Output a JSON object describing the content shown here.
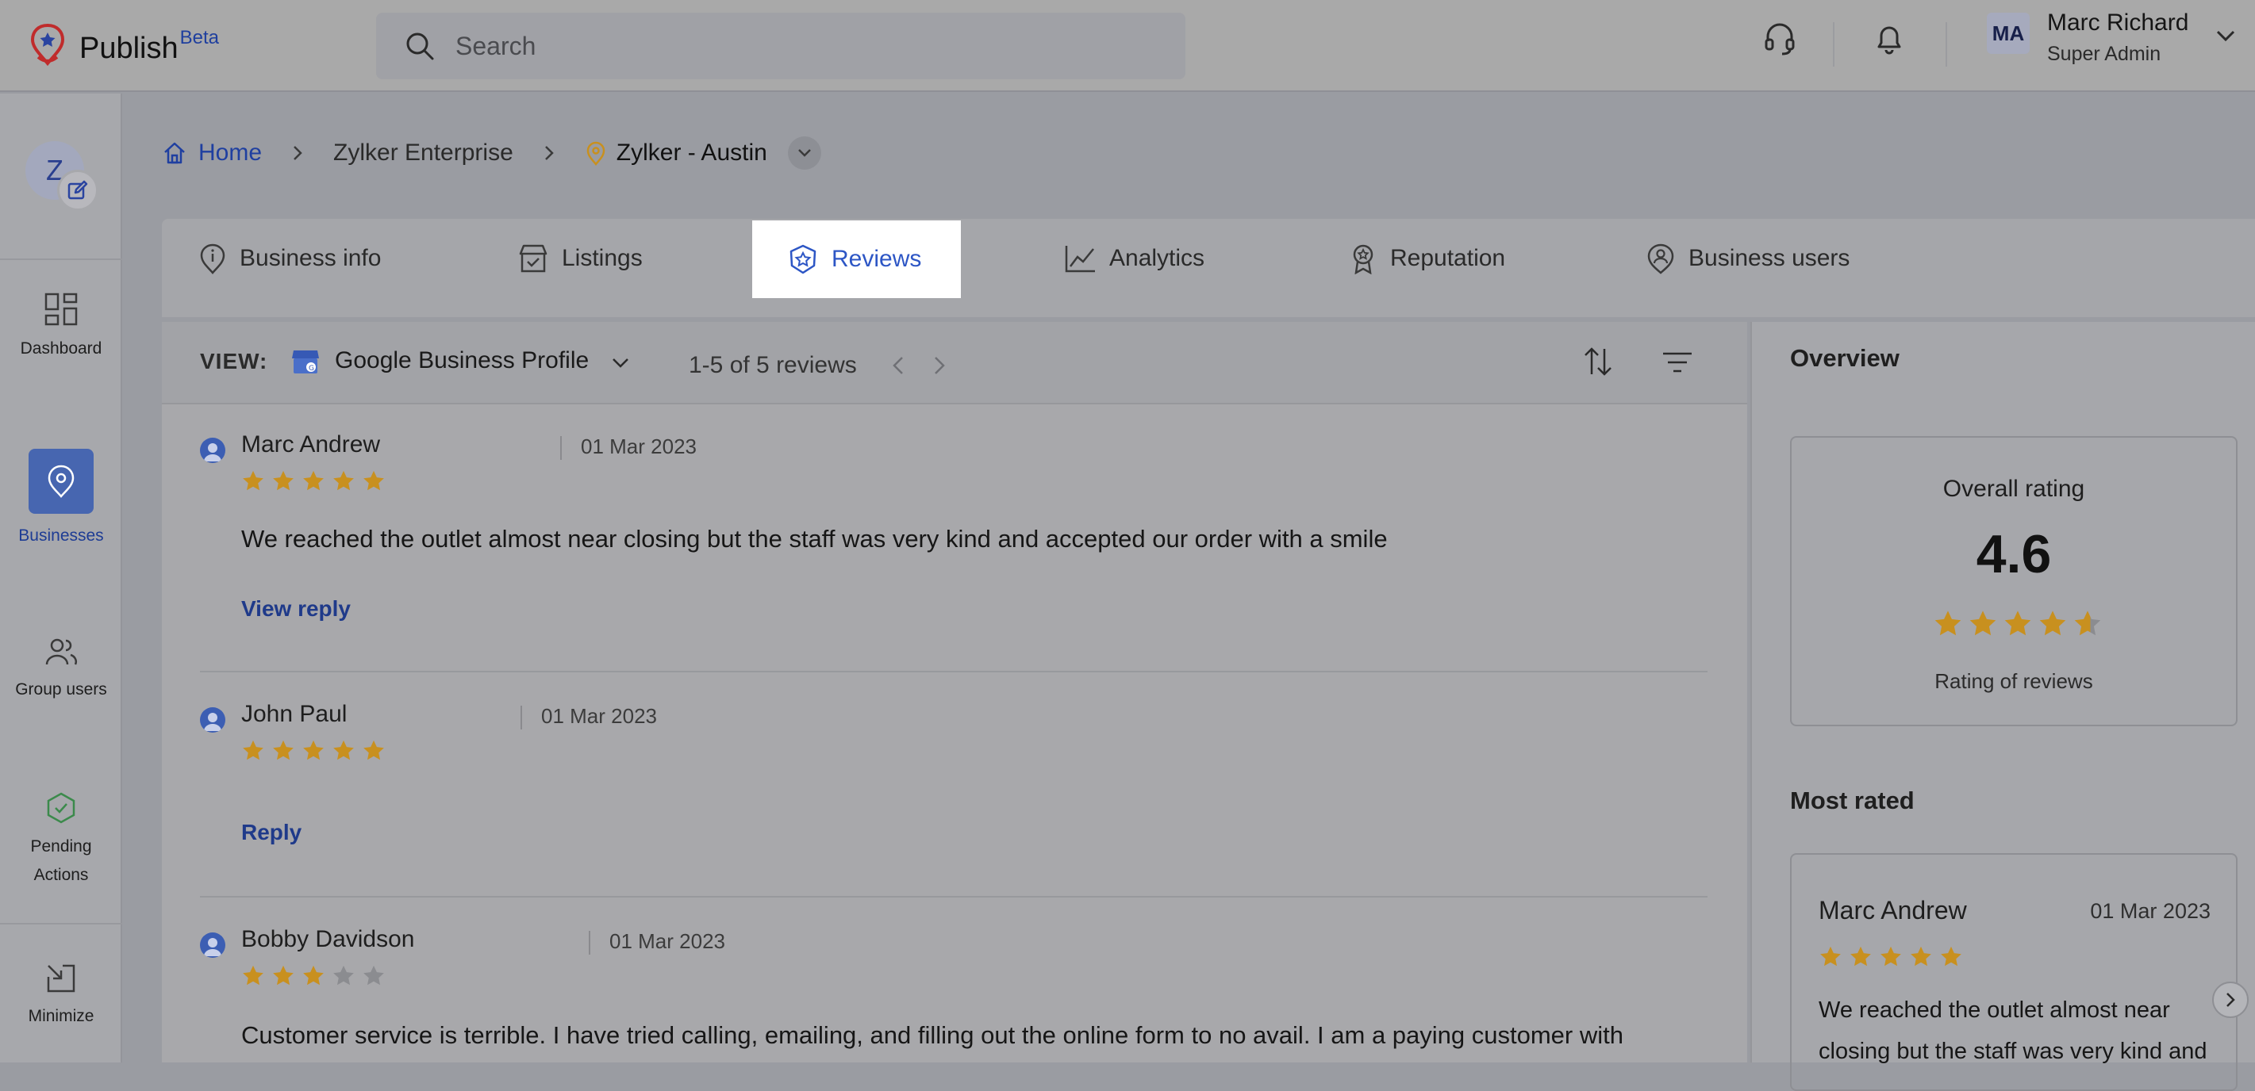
{
  "app": {
    "name": "Publish",
    "badge": "Beta",
    "search_placeholder": "Search"
  },
  "user": {
    "initials": "MA",
    "name": "Marc Richard",
    "role": "Super Admin"
  },
  "business_avatar": "Z",
  "sidebar": {
    "items": [
      {
        "label": "Dashboard",
        "icon": "dashboard-icon"
      },
      {
        "label": "Businesses",
        "icon": "location-pin-icon",
        "active": true
      },
      {
        "label": "Group users",
        "icon": "group-users-icon"
      },
      {
        "label": "Pending",
        "label2": "Actions",
        "icon": "shield-check-icon"
      },
      {
        "label": "Minimize",
        "icon": "minimize-icon"
      }
    ]
  },
  "breadcrumb": {
    "home": "Home",
    "level1": "Zylker Enterprise",
    "level2": "Zylker - Austin"
  },
  "tabs": [
    {
      "label": "Business info",
      "icon": "info-pin-icon"
    },
    {
      "label": "Listings",
      "icon": "store-check-icon"
    },
    {
      "label": "Reviews",
      "icon": "star-badge-icon",
      "active": true
    },
    {
      "label": "Analytics",
      "icon": "line-chart-icon"
    },
    {
      "label": "Reputation",
      "icon": "award-ribbon-icon"
    },
    {
      "label": "Business users",
      "icon": "user-pin-icon"
    }
  ],
  "review_toolbar": {
    "view_label": "VIEW:",
    "source": "Google Business Profile",
    "count": "1-5 of 5 reviews"
  },
  "reviews": [
    {
      "name": "Marc Andrew",
      "date": "01 Mar 2023",
      "rating": 5,
      "text": "We reached the outlet almost near closing but the staff was very kind and accepted our order with a smile",
      "action": "View reply"
    },
    {
      "name": "John Paul",
      "date": "01 Mar 2023",
      "rating": 5,
      "text": "",
      "action": "Reply"
    },
    {
      "name": "Bobby Davidson",
      "date": "01 Mar 2023",
      "rating": 3,
      "text": "Customer service is terrible. I have tried calling, emailing, and filling out the online form to no avail. I am a paying customer with",
      "action": ""
    }
  ],
  "overview": {
    "title": "Overview",
    "overall_label": "Overall rating",
    "score": "4.6",
    "score_value": 4.6,
    "rating_caption": "Rating of reviews",
    "most_rated_title": "Most rated",
    "most_rated": {
      "name": "Marc Andrew",
      "date": "01 Mar 2023",
      "rating": 5,
      "text": "We reached the outlet almost near closing but the staff was very kind and"
    }
  },
  "colors": {
    "accent": "#2d56c5",
    "link": "#1f3a8a",
    "star": "#c8901f",
    "star_empty": "#8b8c90"
  }
}
